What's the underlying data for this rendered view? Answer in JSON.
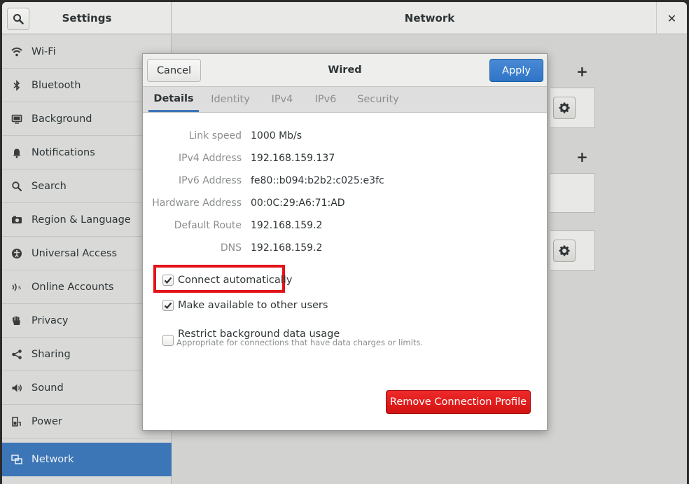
{
  "header": {
    "settings_title": "Settings",
    "network_title": "Network",
    "close_label": "✕"
  },
  "sidebar": {
    "items": [
      {
        "label": "Wi-Fi",
        "icon": "wifi-icon"
      },
      {
        "label": "Bluetooth",
        "icon": "bluetooth-icon"
      },
      {
        "label": "Background",
        "icon": "background-icon"
      },
      {
        "label": "Notifications",
        "icon": "bell-icon"
      },
      {
        "label": "Search",
        "icon": "search-icon"
      },
      {
        "label": "Region & Language",
        "icon": "camera-icon"
      },
      {
        "label": "Universal Access",
        "icon": "accessibility-icon"
      },
      {
        "label": "Online Accounts",
        "icon": "online-accounts-icon"
      },
      {
        "label": "Privacy",
        "icon": "hand-icon"
      },
      {
        "label": "Sharing",
        "icon": "share-icon"
      },
      {
        "label": "Sound",
        "icon": "speaker-icon"
      },
      {
        "label": "Power",
        "icon": "power-icon"
      },
      {
        "label": "Network",
        "icon": "network-icon",
        "active": true
      }
    ]
  },
  "dialog": {
    "title": "Wired",
    "cancel_label": "Cancel",
    "apply_label": "Apply",
    "tabs": [
      {
        "label": "Details",
        "active": true
      },
      {
        "label": "Identity"
      },
      {
        "label": "IPv4"
      },
      {
        "label": "IPv6"
      },
      {
        "label": "Security"
      }
    ],
    "details": [
      {
        "label": "Link speed",
        "value": "1000 Mb/s"
      },
      {
        "label": "IPv4 Address",
        "value": "192.168.159.137"
      },
      {
        "label": "IPv6 Address",
        "value": "fe80::b094:b2b2:c025:e3fc"
      },
      {
        "label": "Hardware Address",
        "value": "00:0C:29:A6:71:AD"
      },
      {
        "label": "Default Route",
        "value": "192.168.159.2"
      },
      {
        "label": "DNS",
        "value": "192.168.159.2"
      }
    ],
    "options": [
      {
        "label": "Connect automatically",
        "checked": true
      },
      {
        "label": "Make available to other users",
        "checked": true
      },
      {
        "label": "Restrict background data usage",
        "checked": false,
        "sublabel": "Appropriate for connections that have data charges or limits."
      }
    ],
    "remove_label": "Remove Connection Profile"
  },
  "colors": {
    "accent": "#3d76b6",
    "apply_button": "#2f74c6",
    "destructive": "#d31212",
    "highlight": "#e3131b"
  }
}
